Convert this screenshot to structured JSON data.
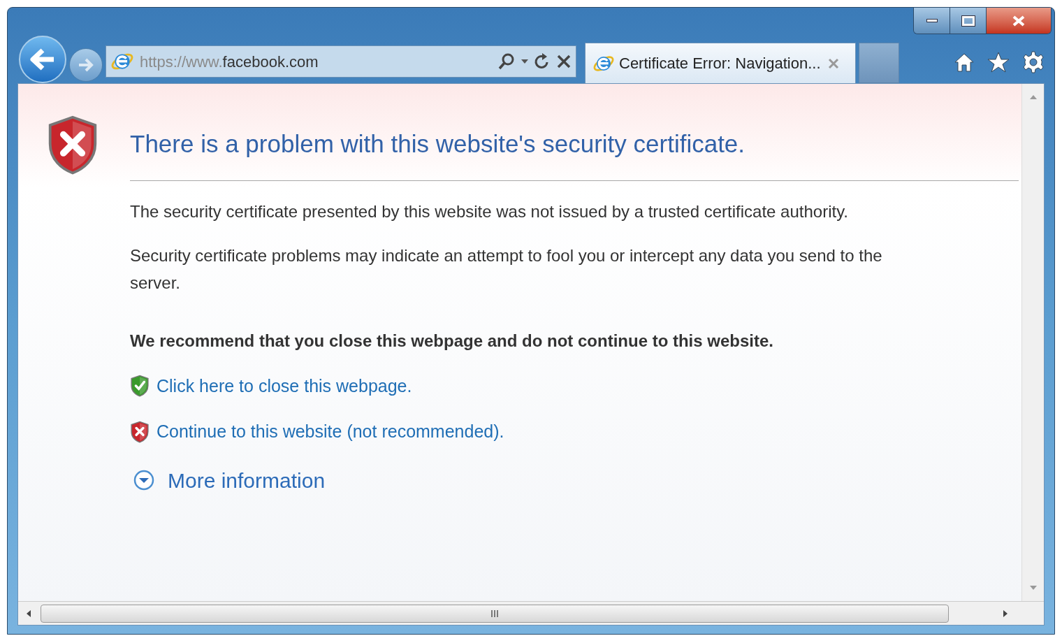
{
  "address_bar": {
    "url_prefix": "https://www.",
    "url_domain": "facebook.com"
  },
  "tabs": [
    {
      "title": "Certificate Error: Navigation...",
      "selected": true
    }
  ],
  "page": {
    "title": "There is a problem with this website's security certificate.",
    "paragraphs": [
      "The security certificate presented by this website was not issued by a trusted certificate authority.",
      "Security certificate problems may indicate an attempt to fool you or intercept any data you send to the server."
    ],
    "recommendation": "We recommend that you close this webpage and do not continue to this website.",
    "actions": [
      {
        "kind": "safe",
        "label": "Click here to close this webpage."
      },
      {
        "kind": "danger",
        "label": "Continue to this website (not recommended)."
      }
    ],
    "more_info": {
      "label": "More information",
      "expanded": false
    }
  }
}
